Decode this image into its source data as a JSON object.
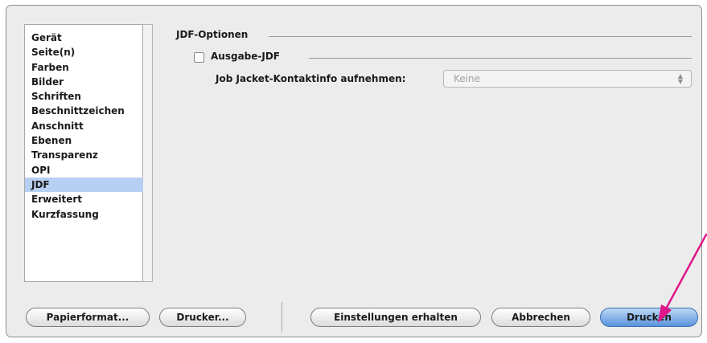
{
  "sidebar": {
    "items": [
      {
        "label": "Gerät"
      },
      {
        "label": "Seite(n)"
      },
      {
        "label": "Farben"
      },
      {
        "label": "Bilder"
      },
      {
        "label": "Schriften"
      },
      {
        "label": "Beschnittzeichen"
      },
      {
        "label": "Anschnitt"
      },
      {
        "label": "Ebenen"
      },
      {
        "label": "Transparenz"
      },
      {
        "label": "OPI"
      },
      {
        "label": "JDF"
      },
      {
        "label": "Erweitert"
      },
      {
        "label": "Kurzfassung"
      }
    ],
    "selected": "JDF"
  },
  "jdf_options": {
    "group_title": "JDF-Optionen",
    "output_checkbox_label": "Ausgabe-JDF",
    "output_checked": false,
    "contact_label": "Job Jacket-Kontaktinfo aufnehmen:",
    "contact_value": "Keine"
  },
  "buttons": {
    "paper_format": "Papierformat...",
    "printer": "Drucker...",
    "keep_settings": "Einstellungen erhalten",
    "cancel": "Abbrechen",
    "print": "Drucken"
  },
  "colors": {
    "selection": "#b6cff2",
    "default_button": "#5a93db",
    "annotation_arrow": "#e0168a"
  }
}
